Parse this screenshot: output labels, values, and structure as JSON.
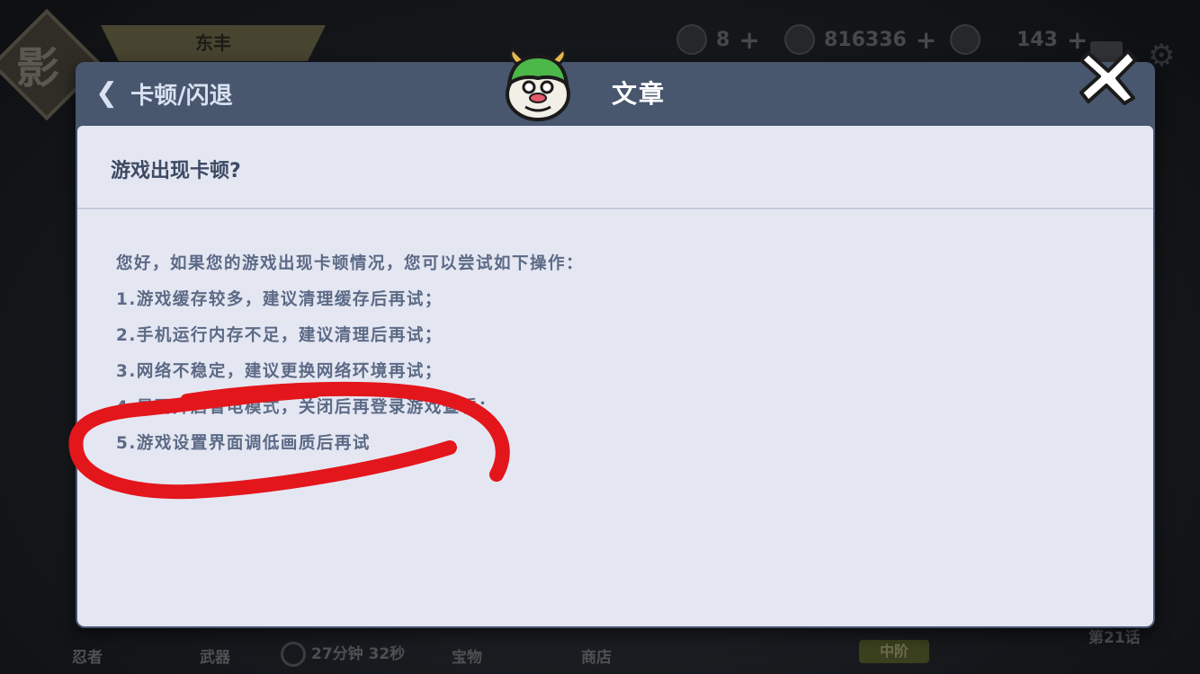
{
  "background": {
    "banner_text": "东丰",
    "logo_glyph": "影",
    "resources": [
      {
        "icon": "onigiri-icon",
        "value": "8"
      },
      {
        "icon": "coin-icon",
        "value": "816336"
      },
      {
        "icon": "gem-icon",
        "value": "143"
      }
    ],
    "bottom_nav": {
      "ninja": "忍者",
      "weapon": "武器",
      "timer": "27分钟 32秒",
      "treasure": "宝物",
      "shop": "商店",
      "tier": "中阶",
      "chapter": "第21话"
    }
  },
  "dialog": {
    "back_label": "卡顿/闪退",
    "title": "文章",
    "question": "游戏出现卡顿?",
    "answer_lines": [
      "您好，如果您的游戏出现卡顿情况，您可以尝试如下操作：",
      "1.游戏缓存较多，建议清理缓存后再试；",
      "2.手机运行内存不足，建议清理后再试；",
      "3.网络不稳定，建议更换网络环境再试；",
      "4.是否开启省电模式，关闭后再登录游戏查看；",
      "5.游戏设置界面调低画质后再试"
    ],
    "highlight_color": "#e3161b",
    "header_color": "#48566e",
    "content_color": "#e4e7f2"
  }
}
